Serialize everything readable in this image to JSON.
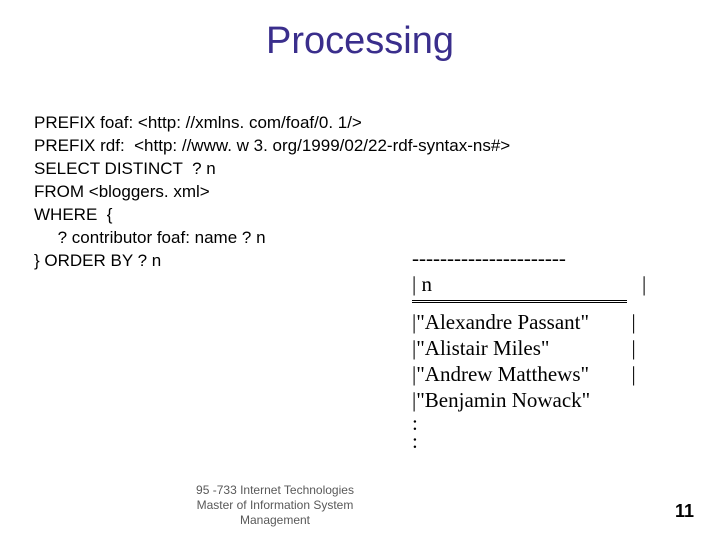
{
  "title": "Processing",
  "query": {
    "line1": "PREFIX foaf: <http: //xmlns. com/foaf/0. 1/>",
    "line2": "PREFIX rdf:  <http: //www. w 3. org/1999/02/22-rdf-syntax-ns#>",
    "line3": "SELECT DISTINCT  ? n",
    "line4": "FROM <bloggers. xml>",
    "line5": "WHERE  {",
    "line6": "     ? contributor foaf: name ? n",
    "line7": "} ORDER BY ? n"
  },
  "results": {
    "dashes": "----------------------",
    "header_col": "| n",
    "header_end": "|",
    "rows": [
      {
        "bar": "| ",
        "value": "\"Alexandre Passant\"",
        "end": "  |"
      },
      {
        "bar": "| ",
        "value": "\"Alistair Miles\"",
        "end": "          |"
      },
      {
        "bar": "| ",
        "value": "\"Andrew Matthews\"",
        "end": "   |"
      },
      {
        "bar": "| ",
        "value": "\"Benjamin Nowack\"",
        "end": ""
      }
    ],
    "trailing_dots": [
      ":",
      ":"
    ]
  },
  "footer": {
    "line1": "95 -733 Internet Technologies",
    "line2": "Master of Information System",
    "line3": "Management",
    "page_number": "11"
  }
}
